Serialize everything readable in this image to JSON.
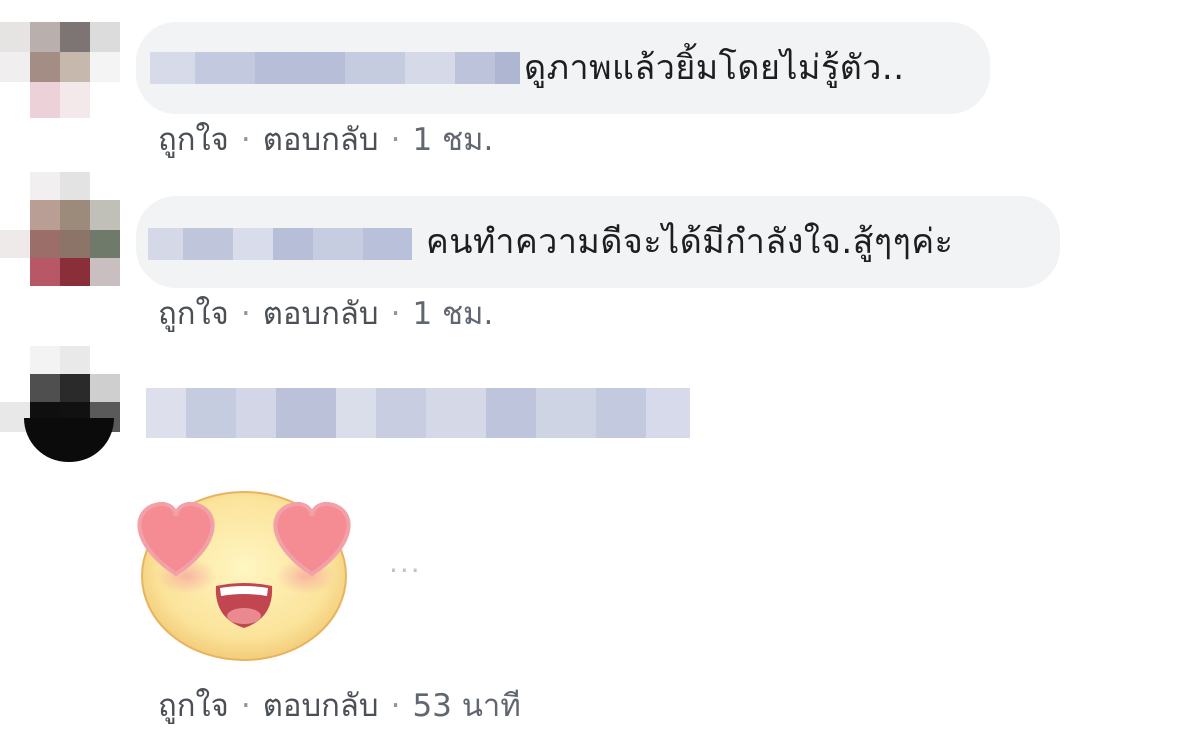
{
  "comments": [
    {
      "text": "ดูภาพแล้วยิ้มโดยไม่รู้ตัว..",
      "actions": {
        "like": "ถูกใจ",
        "reply": "ตอบกลับ",
        "separator": "·",
        "time": "1 ชม."
      }
    },
    {
      "text": "คนทำความดีจะได้มีกำลังใจ.สู้ๆๆค่ะ",
      "actions": {
        "like": "ถูกใจ",
        "reply": "ตอบกลับ",
        "separator": "·",
        "time": "1 ชม."
      }
    },
    {
      "text": "",
      "sticker": "heart-eyes-emoji-sticker",
      "more": "...",
      "actions": {
        "like": "ถูกใจ",
        "reply": "ตอบกลับ",
        "separator": "·",
        "time": "53 นาที"
      }
    }
  ],
  "colors": {
    "bubble": "#f2f3f5",
    "text": "#1c1e21",
    "action_text": "#4b4f56",
    "blur_name": "#c9cfe2"
  }
}
